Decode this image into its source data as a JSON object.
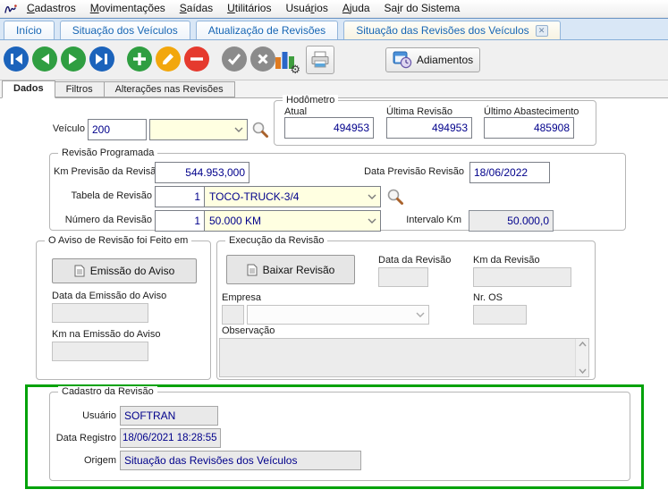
{
  "menu": {
    "items": [
      {
        "label": "Cadastros",
        "accel": 0
      },
      {
        "label": "Movimentações",
        "accel": 0
      },
      {
        "label": "Saídas",
        "accel": 0
      },
      {
        "label": "Utilitários",
        "accel": 0
      },
      {
        "label": "Usuários",
        "accel": 4
      },
      {
        "label": "Ajuda",
        "accel": 0
      },
      {
        "label": "Sair do Sistema",
        "accel": 2
      }
    ]
  },
  "tabs": [
    {
      "label": "Início"
    },
    {
      "label": "Situação dos Veículos"
    },
    {
      "label": "Atualização de Revisões"
    },
    {
      "label": "Situação das Revisões dos Veículos"
    }
  ],
  "toolbar": {
    "adiamentos_label": "Adiamentos"
  },
  "subtabs": [
    {
      "label": "Dados"
    },
    {
      "label": "Filtros"
    },
    {
      "label": "Alterações nas Revisões"
    }
  ],
  "vehicle": {
    "label": "Veículo",
    "code": "200",
    "name": ""
  },
  "hodometro": {
    "title": "Hodômetro",
    "atual_label": "Atual",
    "atual": "494953",
    "ultima_revisao_label": "Última Revisão",
    "ultima_revisao": "494953",
    "ultimo_abastecimento_label": "Último Abastecimento",
    "ultimo_abastecimento": "485908"
  },
  "revisao_programada": {
    "title": "Revisão Programada",
    "km_previsao_label": "Km Previsão da Revisão",
    "km_previsao": "544.953,000",
    "data_previsao_label": "Data Previsão Revisão",
    "data_previsao": "18/06/2022",
    "tabela_label": "Tabela de Revisão",
    "tabela_numero": "1",
    "tabela_nome": "TOCO-TRUCK-3/4",
    "numero_label": "Número da Revisão",
    "numero_numero": "1",
    "numero_nome": "50.000 KM",
    "intervalo_label": "Intervalo Km",
    "intervalo": "50.000,0"
  },
  "aviso": {
    "title": "O Aviso de Revisão foi Feito em",
    "emissao_button": "Emissão do Aviso",
    "data_emissao_label": "Data da Emissão do Aviso",
    "data_emissao": "",
    "km_emissao_label": "Km na Emissão do Aviso",
    "km_emissao": ""
  },
  "execucao": {
    "title": "Execução da Revisão",
    "baixar_button": "Baixar Revisão",
    "data_revisao_label": "Data da Revisão",
    "data_revisao": "",
    "km_revisao_label": "Km da Revisão",
    "km_revisao": "",
    "empresa_label": "Empresa",
    "empresa_codigo": "",
    "empresa_nome": "",
    "nr_os_label": "Nr. OS",
    "nr_os": "",
    "observacao_label": "Observação",
    "observacao": ""
  },
  "cadastro": {
    "title": "Cadastro da Revisão",
    "usuario_label": "Usuário",
    "usuario": "SOFTRAN",
    "data_registro_label": "Data Registro",
    "data_registro": "18/06/2021 18:28:55",
    "origem_label": "Origem",
    "origem": "Situação das Revisões dos Veículos"
  },
  "icons": {
    "gear_glyph": "⚙",
    "close_glyph": "✕"
  },
  "colors": {
    "highlight_green": "#00a20a",
    "field_value_navy": "#00008b",
    "combo_yellow": "#ffffe1",
    "tab_text_blue": "#1565b4"
  }
}
